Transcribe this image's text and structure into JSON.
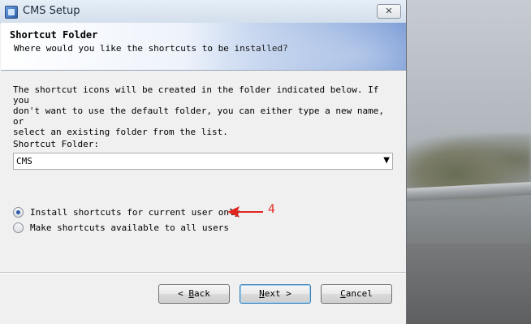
{
  "window": {
    "title": "CMS Setup",
    "close_glyph": "✕",
    "app_icon": "cms-setup-icon"
  },
  "header": {
    "title": "Shortcut Folder",
    "subtitle": "Where would you like the shortcuts to be installed?"
  },
  "body": {
    "description": "The shortcut icons will be created in the folder indicated below. If you\ndon't want to use the default folder, you can either type a new name, or\nselect an existing folder from the list.",
    "folder_label": "Shortcut Folder:",
    "folder_value": "CMS",
    "dropdown_glyph": "▼"
  },
  "options": [
    {
      "label": "Install shortcuts for current user only",
      "checked": true
    },
    {
      "label": "Make shortcuts available to all users",
      "checked": false
    }
  ],
  "annotation": {
    "number": "4",
    "color": "#e0261f"
  },
  "buttons": {
    "back": {
      "prefix": "< ",
      "mnemonic": "B",
      "rest": "ack"
    },
    "next": {
      "mnemonic": "N",
      "rest": "ext",
      "suffix": " >"
    },
    "cancel": {
      "mnemonic": "C",
      "rest": "ancel"
    }
  }
}
